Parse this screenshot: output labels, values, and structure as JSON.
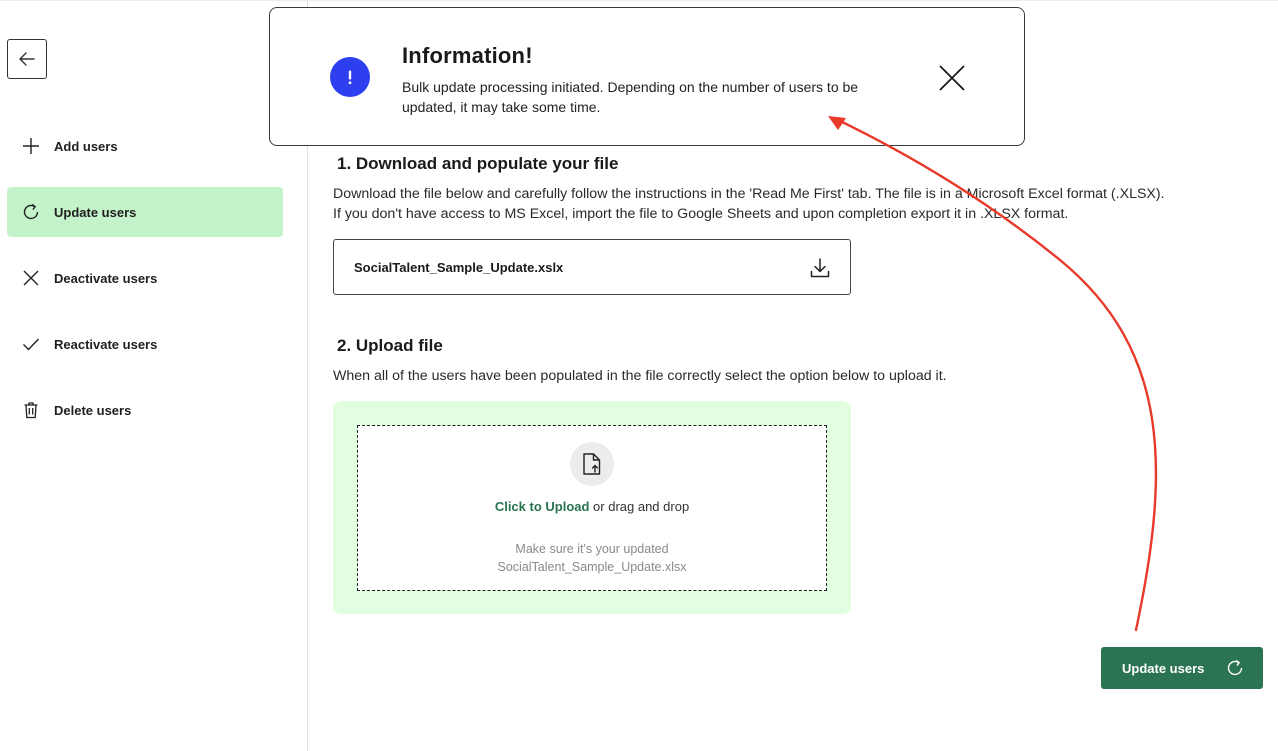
{
  "sidebar": {
    "items": [
      {
        "label": "Add users",
        "icon": "plus-icon",
        "active": false
      },
      {
        "label": "Update users",
        "icon": "refresh-icon",
        "active": true
      },
      {
        "label": "Deactivate users",
        "icon": "x-icon",
        "active": false
      },
      {
        "label": "Reactivate users",
        "icon": "check-icon",
        "active": false
      },
      {
        "label": "Delete users",
        "icon": "trash-icon",
        "active": false
      }
    ]
  },
  "toast": {
    "title": "Information!",
    "message": "Bulk update processing initiated. Depending on the number of users to be updated, it may take some time.",
    "icon": "exclamation-icon"
  },
  "step1": {
    "heading": "1. Download and populate your file",
    "line1": "Download the file below and carefully follow the instructions in the 'Read Me First' tab. The file is in a Microsoft Excel format (.XLSX).",
    "line2": "If you don't have access to MS Excel, import the file to Google Sheets and upon completion export it in .XLSX format.",
    "file_name": "SocialTalent_Sample_Update.xslx"
  },
  "step2": {
    "heading": "2. Upload file",
    "description": "When all of the users have been populated in the file correctly select the option below to upload it.",
    "upload_link": "Click to Upload",
    "upload_rest": " or drag and drop",
    "hint_line1": "Make sure it's your updated",
    "hint_line2": "SocialTalent_Sample_Update.xlsx"
  },
  "actions": {
    "update_label": "Update users"
  },
  "colors": {
    "accent": "#2b7451",
    "active_nav": "#c4f2c9",
    "upload_bg": "#e1ffe0",
    "info": "#2e3ff0",
    "annotation": "#e8392a"
  }
}
